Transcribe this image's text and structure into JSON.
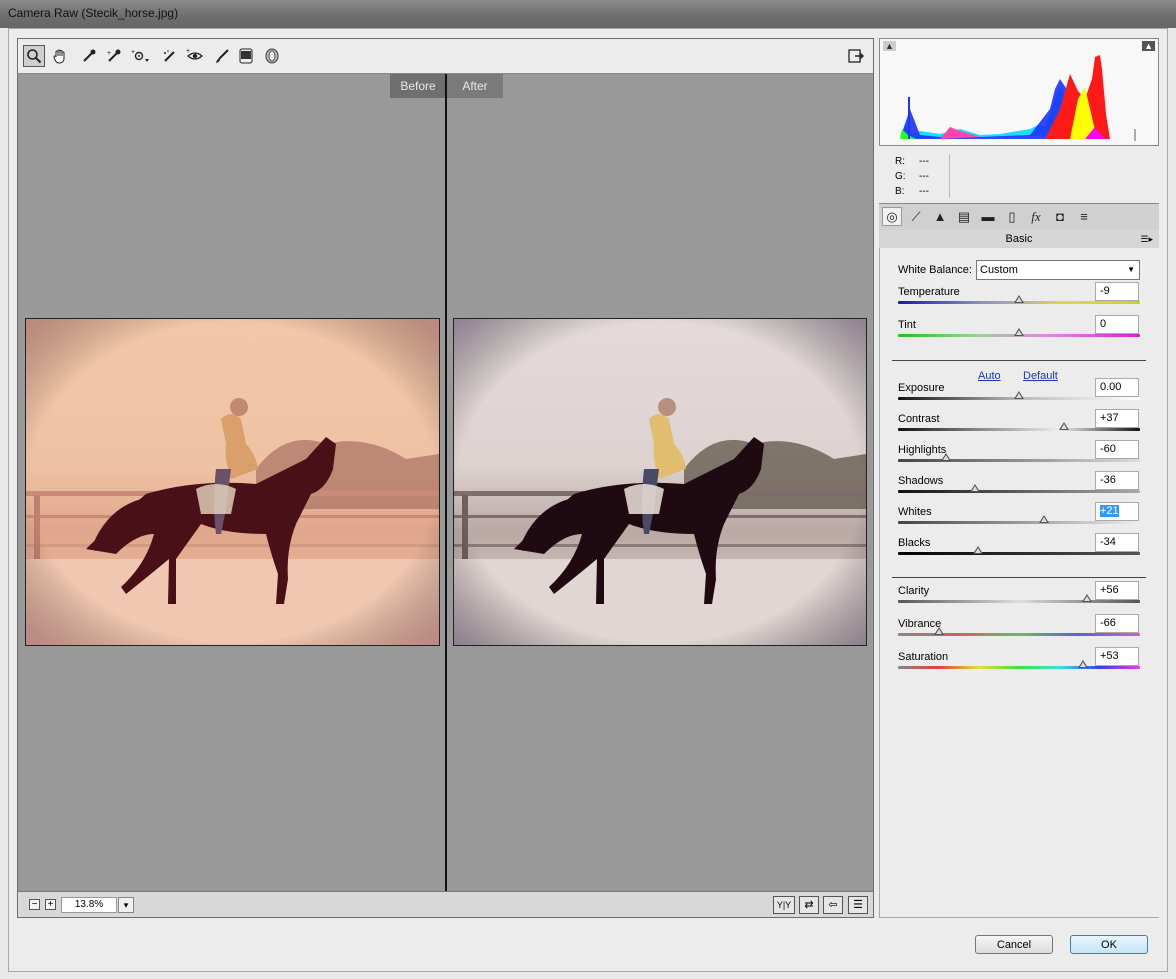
{
  "window": {
    "title": "Camera Raw (Stecik_horse.jpg)"
  },
  "toolbar": {
    "tools": [
      {
        "name": "zoom-tool-icon",
        "glyph": "🔍"
      },
      {
        "name": "hand-tool-icon",
        "glyph": "✋"
      },
      {
        "name": "white-balance-tool-icon",
        "glyph": "✒"
      },
      {
        "name": "color-sampler-tool-icon",
        "glyph": "✒"
      },
      {
        "name": "targeted-adjustment-tool-icon",
        "glyph": "⊙"
      },
      {
        "name": "spot-removal-tool-icon",
        "glyph": "✎"
      },
      {
        "name": "red-eye-removal-tool-icon",
        "glyph": "◉"
      },
      {
        "name": "adjustment-brush-icon",
        "glyph": "🖌"
      },
      {
        "name": "graduated-filter-icon",
        "glyph": "▣"
      },
      {
        "name": "radial-filter-icon",
        "glyph": "◯"
      }
    ],
    "open_preferences_glyph": "⇲"
  },
  "preview": {
    "before_label": "Before",
    "after_label": "After"
  },
  "status": {
    "zoom_out": "−",
    "zoom_in": "+",
    "zoom_value": "13.8%",
    "zoom_dropdown": "▾",
    "view_buttons": [
      {
        "name": "before-after-view-button",
        "glyph": "Y|Y"
      },
      {
        "name": "swap-settings-button",
        "glyph": "⇄"
      },
      {
        "name": "copy-settings-button",
        "glyph": "⇦"
      },
      {
        "name": "toggle-settings-button",
        "glyph": "☰"
      }
    ]
  },
  "histogram": {
    "r_label": "R:",
    "r_value": "---",
    "g_label": "G:",
    "g_value": "---",
    "b_label": "B:",
    "b_value": "---",
    "shadow_clip_glyph": "▲",
    "highlight_clip_glyph": "▲"
  },
  "panel_tabs": [
    {
      "name": "basic-tab-icon",
      "glyph": "◎"
    },
    {
      "name": "tone-curve-tab-icon",
      "glyph": "⟋"
    },
    {
      "name": "detail-tab-icon",
      "glyph": "▲"
    },
    {
      "name": "hsl-tab-icon",
      "glyph": "▤"
    },
    {
      "name": "split-toning-tab-icon",
      "glyph": "▬"
    },
    {
      "name": "lens-corrections-tab-icon",
      "glyph": "▯"
    },
    {
      "name": "effects-tab-icon",
      "glyph": "fx"
    },
    {
      "name": "camera-calibration-tab-icon",
      "glyph": "◘"
    },
    {
      "name": "presets-tab-icon",
      "glyph": "≡"
    }
  ],
  "basic": {
    "title": "Basic",
    "white_balance_label": "White Balance:",
    "white_balance_value": "Custom",
    "auto_link": "Auto",
    "default_link": "Default",
    "sliders": [
      {
        "key": "temperature",
        "label": "Temperature",
        "value": "-9",
        "level": 0.5
      },
      {
        "key": "tint",
        "label": "Tint",
        "value": "0",
        "level": 0.5
      },
      {
        "key": "exposure",
        "label": "Exposure",
        "value": "0.00",
        "level": 0.5
      },
      {
        "key": "contrast",
        "label": "Contrast",
        "value": "+37",
        "level": 0.685
      },
      {
        "key": "highlights",
        "label": "Highlights",
        "value": "-60",
        "level": 0.2
      },
      {
        "key": "shadows",
        "label": "Shadows",
        "value": "-36",
        "level": 0.32
      },
      {
        "key": "whites",
        "label": "Whites",
        "value": "+21",
        "level": 0.605
      },
      {
        "key": "blacks",
        "label": "Blacks",
        "value": "-34",
        "level": 0.33
      },
      {
        "key": "clarity",
        "label": "Clarity",
        "value": "+56",
        "level": 0.78
      },
      {
        "key": "vibrance",
        "label": "Vibrance",
        "value": "-66",
        "level": 0.17
      },
      {
        "key": "saturation",
        "label": "Saturation",
        "value": "+53",
        "level": 0.765
      }
    ]
  },
  "buttons": {
    "cancel": "Cancel",
    "ok": "OK"
  },
  "colors": {
    "selection": "#3399ff",
    "link": "#1a35b5",
    "preview_bg": "#999999"
  }
}
